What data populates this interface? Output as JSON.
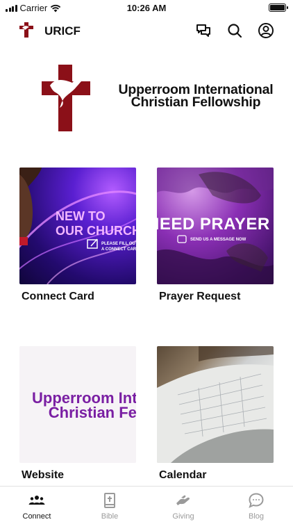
{
  "status_bar": {
    "carrier": "Carrier",
    "time": "10:26 AM"
  },
  "app_bar": {
    "title": "URICF",
    "actions": [
      "chat-icon",
      "search-icon",
      "account-icon"
    ]
  },
  "header": {
    "org_line1": "Upperroom International",
    "org_line2": "Christian Fellowship"
  },
  "tiles": [
    {
      "label": "Connect Card",
      "banner_line1": "NEW TO",
      "banner_line2": "OUR CHURCH",
      "note_line1": "PLEASE FILL OUT",
      "note_line2": "A CONNECT CARD"
    },
    {
      "label": "Prayer Request",
      "banner": "NEED PRAYER",
      "note": "SEND US A MESSAGE NOW"
    },
    {
      "label": "Website",
      "text_line1": "Upperroom International",
      "text_line2": "Christian Fellowship"
    },
    {
      "label": "Calendar"
    }
  ],
  "tab_bar": {
    "items": [
      {
        "label": "Connect",
        "icon": "people-icon",
        "active": true
      },
      {
        "label": "Bible",
        "icon": "bible-icon",
        "active": false
      },
      {
        "label": "Giving",
        "icon": "giving-hand-icon",
        "active": false
      },
      {
        "label": "Blog",
        "icon": "blog-bubble-icon",
        "active": false
      }
    ]
  },
  "colors": {
    "brand_red": "#8b1018",
    "accent_purple": "#7a1fa3",
    "inactive": "#9a9a9a"
  }
}
